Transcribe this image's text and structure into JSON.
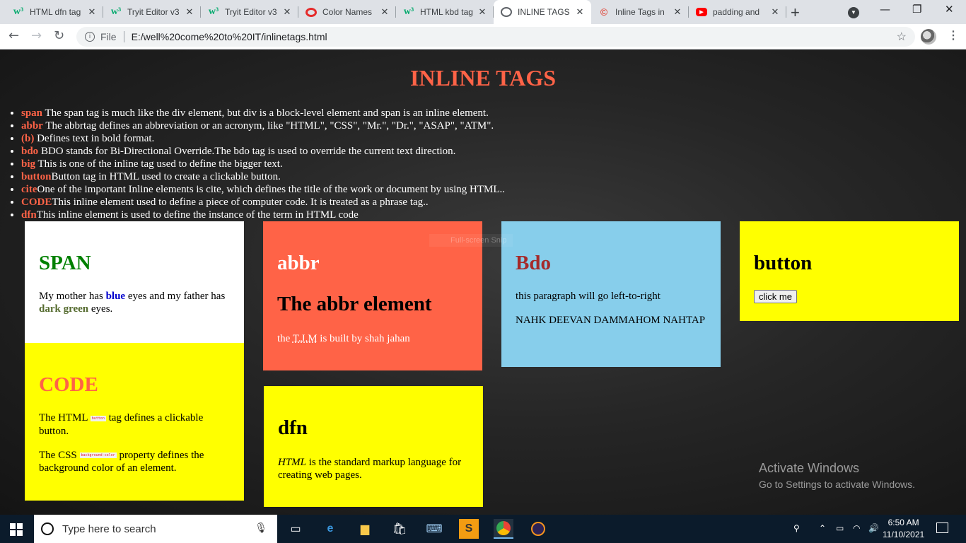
{
  "browser": {
    "tabs": [
      {
        "label": "HTML dfn tag",
        "icon": "w3schools-icon"
      },
      {
        "label": "Tryit Editor v3",
        "icon": "w3schools-icon"
      },
      {
        "label": "Tryit Editor v3",
        "icon": "w3schools-icon"
      },
      {
        "label": "Color Names",
        "icon": "opera-icon"
      },
      {
        "label": "HTML kbd tag",
        "icon": "w3schools-icon"
      },
      {
        "label": "INLINE TAGS",
        "icon": "globe-icon"
      },
      {
        "label": "Inline Tags in",
        "icon": "c-logo-icon"
      },
      {
        "label": "padding and",
        "icon": "youtube-icon"
      }
    ],
    "active_tab": 5,
    "new_tab_glyph": "+",
    "omnibox": {
      "scheme_label": "File",
      "url": "E:/well%20come%20to%20IT/inlinetags.html"
    }
  },
  "page": {
    "title": "INLINE TAGS",
    "items": [
      {
        "tag": "span",
        "text": " The span tag is much like the div element, but div is a block-level element and span is an inline element."
      },
      {
        "tag": "abbr",
        "text": " The abbrtag defines an abbreviation or an acronym, like \"HTML\", \"CSS\", \"Mr.\", \"Dr.\", \"ASAP\", \"ATM\"."
      },
      {
        "tag": "(b)",
        "text": " Defines text in bold format."
      },
      {
        "tag": "bdo",
        "text": " BDO stands for Bi-Directional Override.The bdo tag is used to override the current text direction."
      },
      {
        "tag": "big",
        "text": " This is one of the inline tag used to define the bigger text."
      },
      {
        "tag": "button",
        "text": "Button tag in HTML used to create a clickable button."
      },
      {
        "tag": "cite",
        "text": "One of the important Inline elements is cite, which defines the title of the work or document by using HTML.."
      },
      {
        "tag": "CODE",
        "text": "This inline element used to define a piece of computer code. It is treated as a phrase tag.."
      },
      {
        "tag": "dfn",
        "text": "This inline element is used to define the instance of the term in HTML code"
      }
    ],
    "boxes": {
      "span": {
        "heading": "SPAN",
        "text_before": "My mother has ",
        "blue_word": "blue",
        "text_middle": " eyes and my father has ",
        "green_word": "dark green",
        "text_after": " eyes.",
        "heading_color": "#008000",
        "blue_color": "#0000cd",
        "green_color": "#556b2f"
      },
      "abbr": {
        "heading": "abbr",
        "subheading": "The abbr element",
        "text_before": "the ",
        "abbr": "T.J.M",
        "text_after": " is built by shah jahan"
      },
      "bdo": {
        "heading": "Bdo",
        "line1": "this paragraph will go left-to-right",
        "line2": "NAHK DEEVAN DAMMAHOM NAHTAP",
        "heading_color": "#a52a2a"
      },
      "button": {
        "heading": "button",
        "button_label": "click me"
      },
      "code": {
        "heading": "CODE",
        "p1_before": "The HTML ",
        "p1_code": "button",
        "p1_after": " tag defines a clickable button.",
        "p2_before": "The CSS ",
        "p2_code": "background-color",
        "p2_after": " property defines the background color of an element.",
        "heading_color": "#ff6347"
      },
      "dfn": {
        "heading": "dfn",
        "term": "HTML",
        "text": " is the standard markup language for creating web pages."
      }
    },
    "snip_hint": "Full-screen Snip",
    "watermark": {
      "line1": "Activate Windows",
      "line2": "Go to Settings to activate Windows."
    }
  },
  "taskbar": {
    "search_placeholder": "Type here to search",
    "apps": [
      "task-view-icon",
      "edge-icon",
      "file-explorer-icon",
      "store-icon",
      "network-app-icon",
      "sublime-icon",
      "chrome-icon",
      "eclipse-icon"
    ],
    "time": "6:50 AM",
    "date": "11/10/2021"
  },
  "colors": {
    "accent": "#ff6347",
    "yellow": "#ffff00",
    "sky": "#87ceeb"
  }
}
